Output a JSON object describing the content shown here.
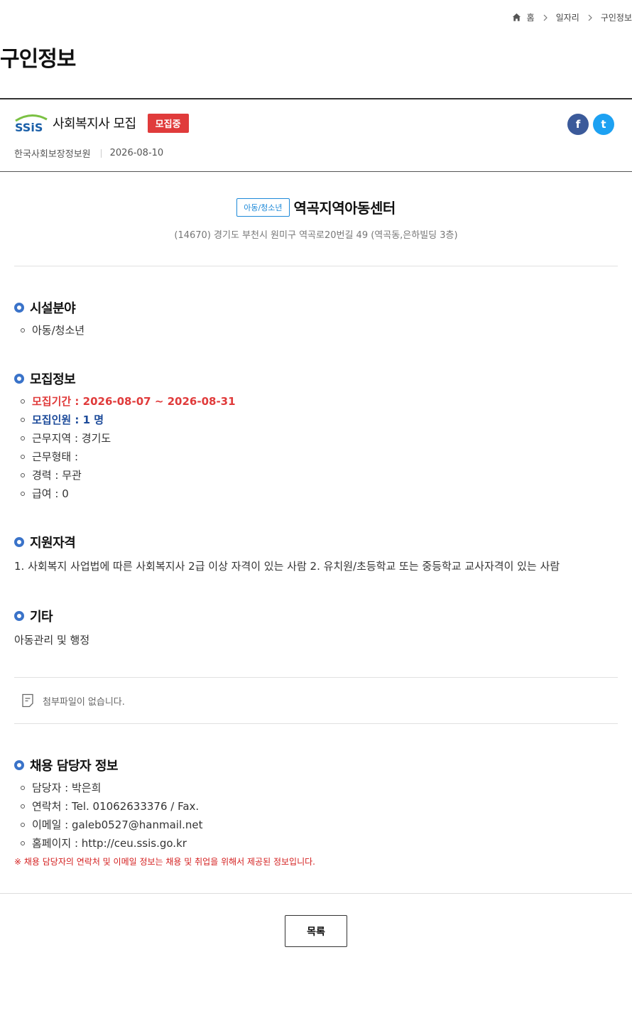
{
  "breadcrumb": {
    "home": "홈",
    "level1": "일자리",
    "level2": "구인정보"
  },
  "page": {
    "title": "구인정보"
  },
  "job": {
    "logo_text": "SSiS",
    "title": "사회복지사 모집",
    "status": "모집중",
    "organization": "한국사회보장정보원",
    "date": "2026-08-10"
  },
  "share": {
    "facebook": "f",
    "twitter": "t"
  },
  "facility": {
    "category": "아동/청소년",
    "name": "역곡지역아동센터",
    "address": "(14670) 경기도 부천시 원미구 역곡로20번길 49 (역곡동,은하빌딩 3층)"
  },
  "sections": {
    "field": {
      "title": "시설분야",
      "items": [
        "아동/청소년"
      ]
    },
    "recruit": {
      "title": "모집정보",
      "period": "모집기간 : 2026-08-07 ~ 2026-08-31",
      "headcount": "모집인원 : 1 명",
      "region": "근무지역 : 경기도",
      "type": "근무형태 :",
      "career": "경력 : 무관",
      "salary": "급여 : 0"
    },
    "qualification": {
      "title": "지원자격",
      "text": "1. 사회복지 사업법에 따른 사회복지사 2급 이상 자격이 있는 사람 2. 유치원/초등학교 또는 중등학교 교사자격이 있는 사람"
    },
    "etc": {
      "title": "기타",
      "text": "아동관리 및 행정"
    },
    "contact": {
      "title": "채용 담당자 정보",
      "manager": "담당자 : 박은희",
      "phone": "연락처 : Tel. 01062633376 / Fax.",
      "email": "이메일 : galeb0527@hanmail.net",
      "homepage": "홈페이지 : http://ceu.ssis.go.kr",
      "notice": "※ 채용 담당자의 연락처 및 이메일 정보는 채용 및 취업을 위해서 제공된 정보입니다."
    }
  },
  "attachment": {
    "text": "첨부파일이 없습니다."
  },
  "buttons": {
    "list": "목록"
  },
  "colors": {
    "accent": "#3a73c9",
    "status": "#e03b3b",
    "category": "#1d89d8",
    "headcount": "#1d4b9a"
  }
}
